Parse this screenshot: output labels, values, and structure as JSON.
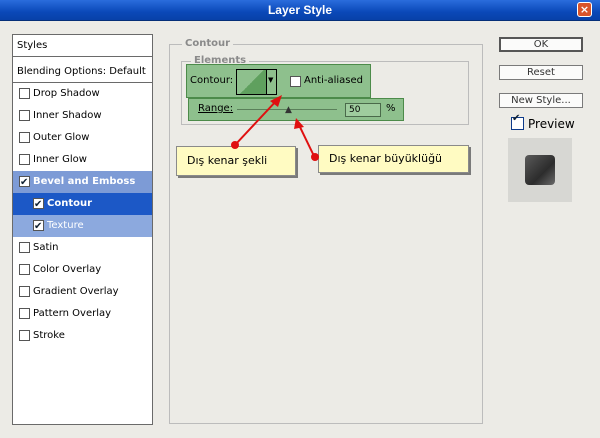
{
  "window": {
    "title": "Layer Style"
  },
  "sidebar": {
    "header": "Styles",
    "blending": "Blending Options: Default",
    "items": [
      {
        "label": "Drop Shadow",
        "checked": false
      },
      {
        "label": "Inner Shadow",
        "checked": false
      },
      {
        "label": "Outer Glow",
        "checked": false
      },
      {
        "label": "Inner Glow",
        "checked": false
      },
      {
        "label": "Bevel and Emboss",
        "checked": true
      },
      {
        "label": "Contour",
        "checked": true
      },
      {
        "label": "Texture",
        "checked": true
      },
      {
        "label": "Satin",
        "checked": false
      },
      {
        "label": "Color Overlay",
        "checked": false
      },
      {
        "label": "Gradient Overlay",
        "checked": false
      },
      {
        "label": "Pattern Overlay",
        "checked": false
      },
      {
        "label": "Stroke",
        "checked": false
      }
    ]
  },
  "contour": {
    "group_title": "Contour",
    "elements_title": "Elements",
    "contour_label": "Contour:",
    "anti_aliased_label": "Anti-aliased",
    "anti_aliased_checked": false,
    "range_label": "Range:",
    "range_value": "50",
    "range_unit": "%"
  },
  "buttons": {
    "ok": "OK",
    "reset": "Reset",
    "new_style": "New Style...",
    "preview_label": "Preview",
    "preview_checked": true
  },
  "callouts": {
    "left": "Dış kenar şekli",
    "right": "Dış kenar büyüklüğü"
  },
  "colors": {
    "title_bar": "#0a48b8",
    "highlight": "#1c58c6",
    "green_panel": "#8ec08d",
    "callout_bg": "#fffbc2",
    "arrow": "#e01010"
  }
}
